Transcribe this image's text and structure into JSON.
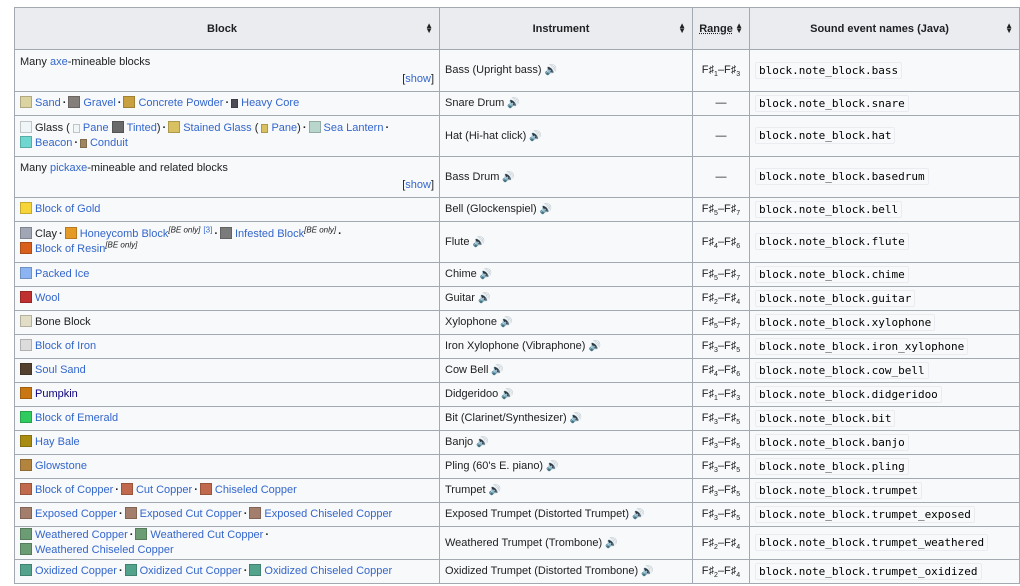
{
  "headers": {
    "block": "Block",
    "instrument": "Instrument",
    "range": "Range",
    "sound": "Sound event names (Java)"
  },
  "show_label": "show",
  "rows": [
    {
      "block_text": "Many axe-mineable blocks",
      "instrument": "Bass (Upright bass)",
      "range": "F♯1–F♯3",
      "sound": "block.note_block.bass"
    },
    {
      "blocks": [
        "Sand",
        "Gravel",
        "Concrete Powder",
        "Heavy Core"
      ],
      "instrument": "Snare Drum",
      "range": "—",
      "sound": "block.note_block.snare"
    },
    {
      "blocks": [
        "Glass",
        "Pane",
        "Tinted",
        "Stained Glass",
        "Pane",
        "Sea Lantern",
        "Beacon",
        "Conduit"
      ],
      "instrument": "Hat (Hi-hat click)",
      "range": "—",
      "sound": "block.note_block.hat"
    },
    {
      "block_text": "Many pickaxe-mineable and related blocks",
      "instrument": "Bass Drum",
      "range": "—",
      "sound": "block.note_block.basedrum"
    },
    {
      "blocks": [
        "Block of Gold"
      ],
      "instrument": "Bell (Glockenspiel)",
      "range": "F♯5–F♯7",
      "sound": "block.note_block.bell"
    },
    {
      "blocks": [
        "Clay",
        "Honeycomb Block",
        "Infested Block",
        "Block of Resin"
      ],
      "be_only": "BE only",
      "ref": "[3]",
      "instrument": "Flute",
      "range": "F♯4–F♯6",
      "sound": "block.note_block.flute"
    },
    {
      "blocks": [
        "Packed Ice"
      ],
      "instrument": "Chime",
      "range": "F♯5–F♯7",
      "sound": "block.note_block.chime"
    },
    {
      "blocks": [
        "Wool"
      ],
      "instrument": "Guitar",
      "range": "F♯2–F♯4",
      "sound": "block.note_block.guitar"
    },
    {
      "blocks": [
        "Bone Block"
      ],
      "instrument": "Xylophone",
      "range": "F♯5–F♯7",
      "sound": "block.note_block.xylophone"
    },
    {
      "blocks": [
        "Block of Iron"
      ],
      "instrument": "Iron Xylophone (Vibraphone)",
      "range": "F♯3–F♯5",
      "sound": "block.note_block.iron_xylophone"
    },
    {
      "blocks": [
        "Soul Sand"
      ],
      "instrument": "Cow Bell",
      "range": "F♯4–F♯6",
      "sound": "block.note_block.cow_bell"
    },
    {
      "blocks": [
        "Pumpkin"
      ],
      "instrument": "Didgeridoo",
      "range": "F♯1–F♯3",
      "sound": "block.note_block.didgeridoo"
    },
    {
      "blocks": [
        "Block of Emerald"
      ],
      "instrument": "Bit (Clarinet/Synthesizer)",
      "range": "F♯3–F♯5",
      "sound": "block.note_block.bit"
    },
    {
      "blocks": [
        "Hay Bale"
      ],
      "instrument": "Banjo",
      "range": "F♯3–F♯5",
      "sound": "block.note_block.banjo"
    },
    {
      "blocks": [
        "Glowstone"
      ],
      "instrument": "Pling (60's E. piano)",
      "range": "F♯3–F♯5",
      "sound": "block.note_block.pling"
    },
    {
      "blocks": [
        "Block of Copper",
        "Cut Copper",
        "Chiseled Copper"
      ],
      "instrument": "Trumpet",
      "range": "F♯3–F♯5",
      "sound": "block.note_block.trumpet"
    },
    {
      "blocks": [
        "Exposed Copper",
        "Exposed Cut Copper",
        "Exposed Chiseled Copper"
      ],
      "instrument": "Exposed Trumpet (Distorted Trumpet)",
      "range": "F♯3–F♯5",
      "sound": "block.note_block.trumpet_exposed"
    },
    {
      "blocks": [
        "Weathered Copper",
        "Weathered Cut Copper",
        "Weathered Chiseled Copper"
      ],
      "instrument": "Weathered Trumpet (Trombone)",
      "range": "F♯2–F♯4",
      "sound": "block.note_block.trumpet_weathered"
    },
    {
      "blocks": [
        "Oxidized Copper",
        "Oxidized Cut Copper",
        "Oxidized Chiseled Copper"
      ],
      "instrument": "Oxidized Trumpet (Distorted Trombone)",
      "range": "F♯2–F♯4",
      "sound": "block.note_block.trumpet_oxidized"
    }
  ],
  "colors": {
    "sand": "#dbd3a0",
    "gravel": "#857f7c",
    "concrete": "#c8a040",
    "heavy_core": "#4a4d55",
    "glass": "#f0f6f8",
    "tinted": "#6a6a6a",
    "stained": "#d9c060",
    "sea_lantern": "#b8d6cc",
    "beacon": "#6fd7d0",
    "conduit": "#a08660",
    "gold": "#f5d53a",
    "clay": "#a0a6b3",
    "honeycomb": "#e59a26",
    "infested": "#7b7b7b",
    "resin": "#d8601c",
    "ice": "#8db4f2",
    "wool": "#c03030",
    "bone": "#e2ddc6",
    "iron": "#dcdcdc",
    "soul_sand": "#54402f",
    "pumpkin": "#c87712",
    "emerald": "#2fcb5e",
    "hay": "#a88c12",
    "glowstone": "#b2843e",
    "copper": "#c0694c",
    "exposed": "#a37e6c",
    "weathered": "#6c9c74",
    "oxidized": "#52a28c"
  }
}
